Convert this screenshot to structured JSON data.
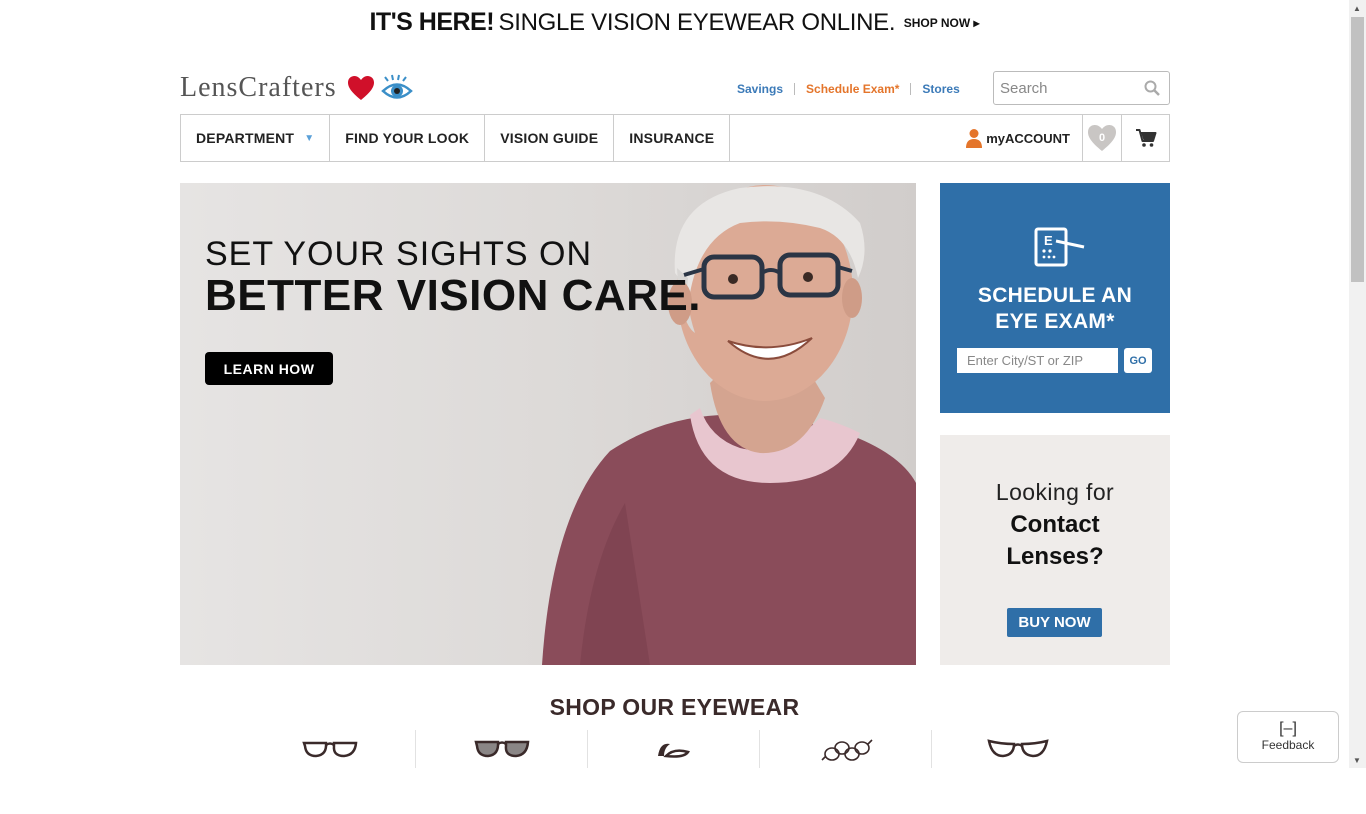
{
  "promo": {
    "bold": "IT'S HERE!",
    "regular": "SINGLE VISION EYEWEAR ONLINE.",
    "shop_now": "SHOP NOW ▸"
  },
  "logo": {
    "text": "LensCrafters"
  },
  "util_links": {
    "savings": "Savings",
    "schedule": "Schedule Exam*",
    "stores": "Stores"
  },
  "search": {
    "placeholder": "Search"
  },
  "nav": {
    "department": "DEPARTMENT",
    "find_your_look": "FIND YOUR LOOK",
    "vision_guide": "VISION GUIDE",
    "insurance": "INSURANCE",
    "account": "myACCOUNT",
    "wishlist_count": "0"
  },
  "hero": {
    "line1": "SET YOUR SIGHTS ON",
    "line2": "BETTER VISION CARE.",
    "button": "LEARN HOW"
  },
  "schedule_box": {
    "title_line1": "SCHEDULE AN",
    "title_line2": "EYE EXAM*",
    "input_placeholder": "Enter City/ST or ZIP",
    "go": "GO"
  },
  "contact_box": {
    "line1": "Looking for",
    "line2": "Contact",
    "line3": "Lenses?",
    "button": "BUY NOW"
  },
  "shop": {
    "title": "SHOP OUR EYEWEAR"
  },
  "feedback": {
    "icon": "[–]",
    "label": "Feedback"
  },
  "colors": {
    "blue": "#2f6fa8",
    "link_blue": "#3b7ab8",
    "orange": "#e4752b",
    "heart_red": "#d0102a"
  }
}
